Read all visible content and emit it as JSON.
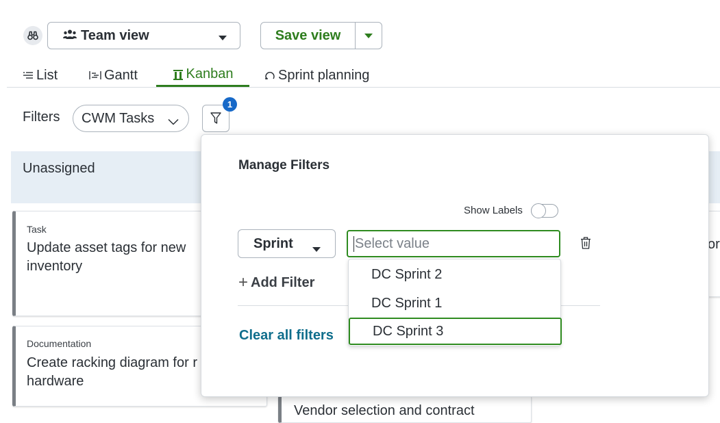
{
  "toolbar": {
    "view_select_label": "Team view",
    "save_view_label": "Save view"
  },
  "tabs": [
    {
      "label": "List"
    },
    {
      "label": "Gantt"
    },
    {
      "label": "Kanban",
      "active": true
    },
    {
      "label": "Sprint planning"
    }
  ],
  "filters": {
    "label": "Filters",
    "selected_filter": "CWM Tasks",
    "badge_count": "1"
  },
  "board": {
    "column_title": "Unassigned",
    "cards": [
      {
        "type": "Task",
        "title_line1": "Update asset tags for new",
        "title_line2": "inventory"
      },
      {
        "type": "Documentation",
        "title_line1": "Create racking diagram for r",
        "title_line2": "hardware"
      },
      {
        "type": "",
        "title_line1": "Vendor selection and contract",
        "title_line2": ""
      }
    ],
    "right_edge_text": "or"
  },
  "manage_filters": {
    "heading": "Manage Filters",
    "show_labels": "Show Labels",
    "show_labels_on": false,
    "field_select": "Sprint",
    "value_placeholder": "Select value",
    "add_filter": "Add Filter",
    "clear_all": "Clear all filters",
    "options": [
      "DC Sprint 2",
      "DC Sprint 1",
      "DC Sprint 3"
    ],
    "highlighted_option": "DC Sprint 3"
  },
  "colors": {
    "accent_green": "#2e7d1e",
    "badge_blue": "#1769c8",
    "link_teal": "#0f6e8c",
    "column_header_bg": "#e6eef5"
  }
}
